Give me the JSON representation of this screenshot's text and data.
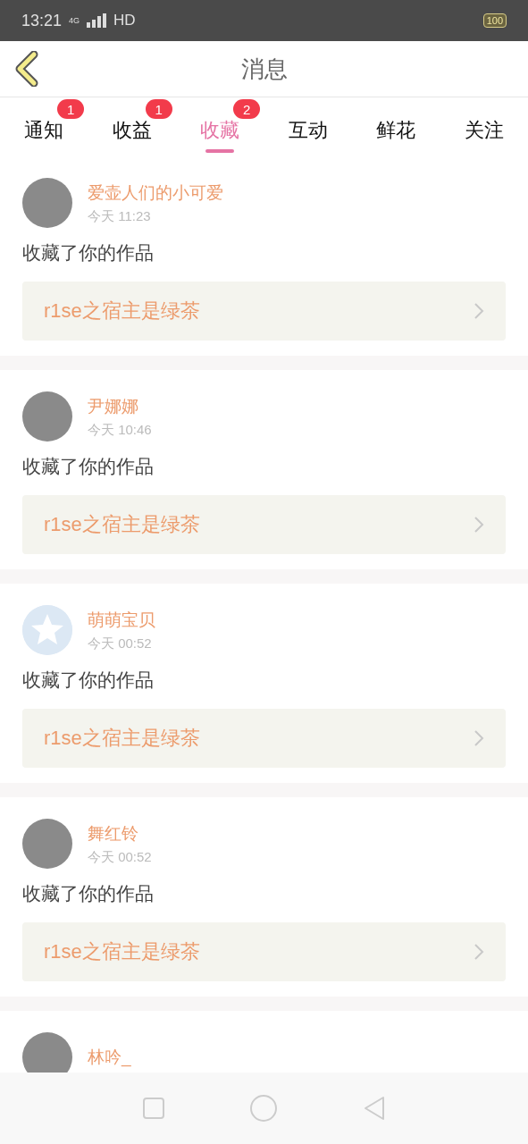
{
  "status_bar": {
    "time": "13:21",
    "network": "4G",
    "hd": "HD",
    "battery": "100"
  },
  "header": {
    "title": "消息"
  },
  "tabs": [
    {
      "label": "通知",
      "badge": "1",
      "selected": false
    },
    {
      "label": "收益",
      "badge": "1",
      "selected": false
    },
    {
      "label": "收藏",
      "badge": "2",
      "selected": true
    },
    {
      "label": "互动",
      "selected": false
    },
    {
      "label": "鲜花",
      "selected": false
    },
    {
      "label": "关注",
      "selected": false
    }
  ],
  "messages": [
    {
      "kind": "photo",
      "name": "爱壶人们的小可爱",
      "time": "今天 11:23",
      "action": "收藏了你的作品",
      "work": "r1se之宿主是绿茶"
    },
    {
      "kind": "photo",
      "name": "尹娜娜",
      "time": "今天 10:46",
      "action": "收藏了你的作品",
      "work": "r1se之宿主是绿茶"
    },
    {
      "kind": "default",
      "name": "萌萌宝贝",
      "time": "今天 00:52",
      "action": "收藏了你的作品",
      "work": "r1se之宿主是绿茶"
    },
    {
      "kind": "photo",
      "name": "舞红铃",
      "time": "今天 00:52",
      "action": "收藏了你的作品",
      "work": "r1se之宿主是绿茶"
    },
    {
      "kind": "photo",
      "name": "林吟_"
    }
  ]
}
